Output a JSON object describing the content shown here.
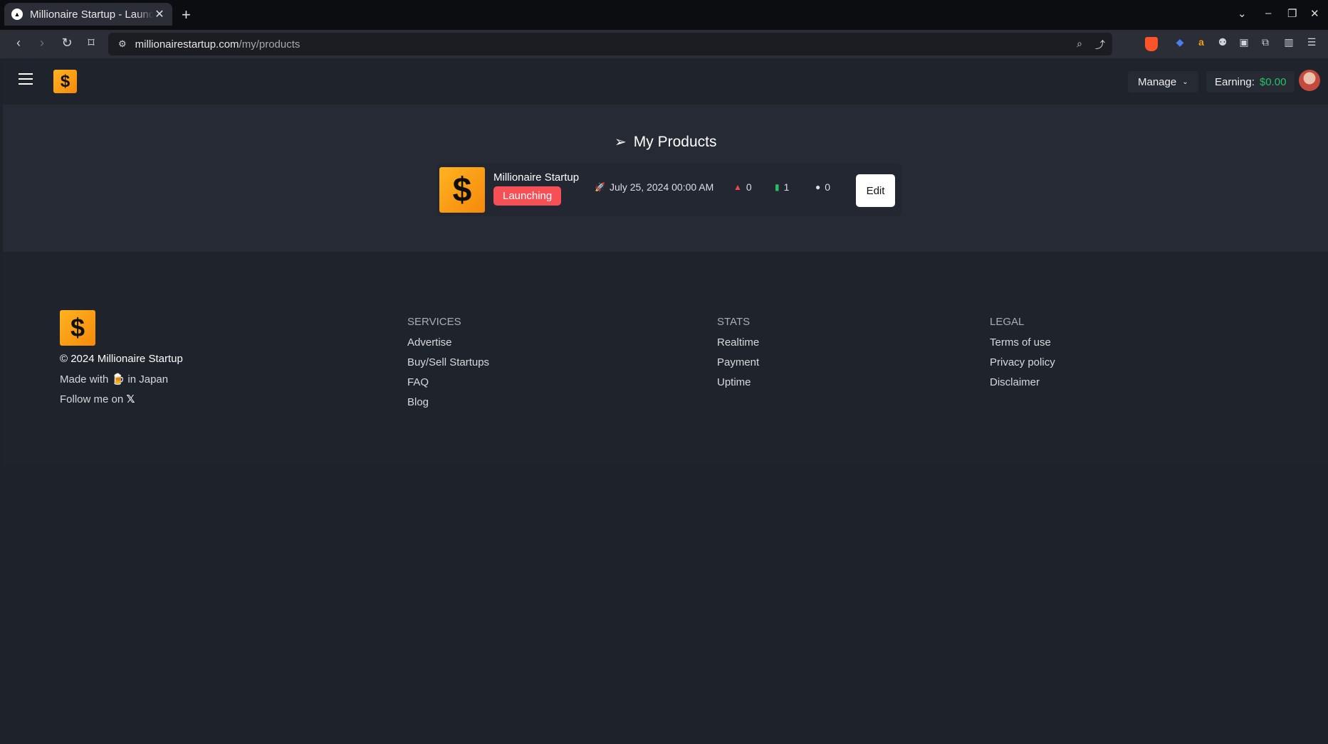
{
  "browser": {
    "tab_title": "Millionaire Startup - Launching",
    "url_host": "millionairestartup.com",
    "url_path": "/my/products"
  },
  "header": {
    "manage_label": "Manage",
    "earning_label": "Earning:",
    "earning_value": "$0.00"
  },
  "main": {
    "title": "My Products",
    "product": {
      "name": "Millionaire Startup",
      "status": "Launching",
      "launch_date": "July 25, 2024 00:00 AM",
      "upvotes": "0",
      "views": "1",
      "comments": "0",
      "edit_label": "Edit"
    }
  },
  "footer": {
    "copyright": "© 2024 Millionaire Startup",
    "made_with_prefix": "Made with",
    "made_with_suffix": "in Japan",
    "follow": "Follow me on",
    "services": {
      "heading": "SERVICES",
      "links": [
        "Advertise",
        "Buy/Sell Startups",
        "FAQ",
        "Blog"
      ]
    },
    "stats": {
      "heading": "STATS",
      "links": [
        "Realtime",
        "Payment",
        "Uptime"
      ]
    },
    "legal": {
      "heading": "LEGAL",
      "links": [
        "Terms of use",
        "Privacy policy",
        "Disclaimer"
      ]
    }
  },
  "colors": {
    "accent_orange": "#f5a11b",
    "badge_red": "#f64f55",
    "earning_green": "#27c165"
  }
}
